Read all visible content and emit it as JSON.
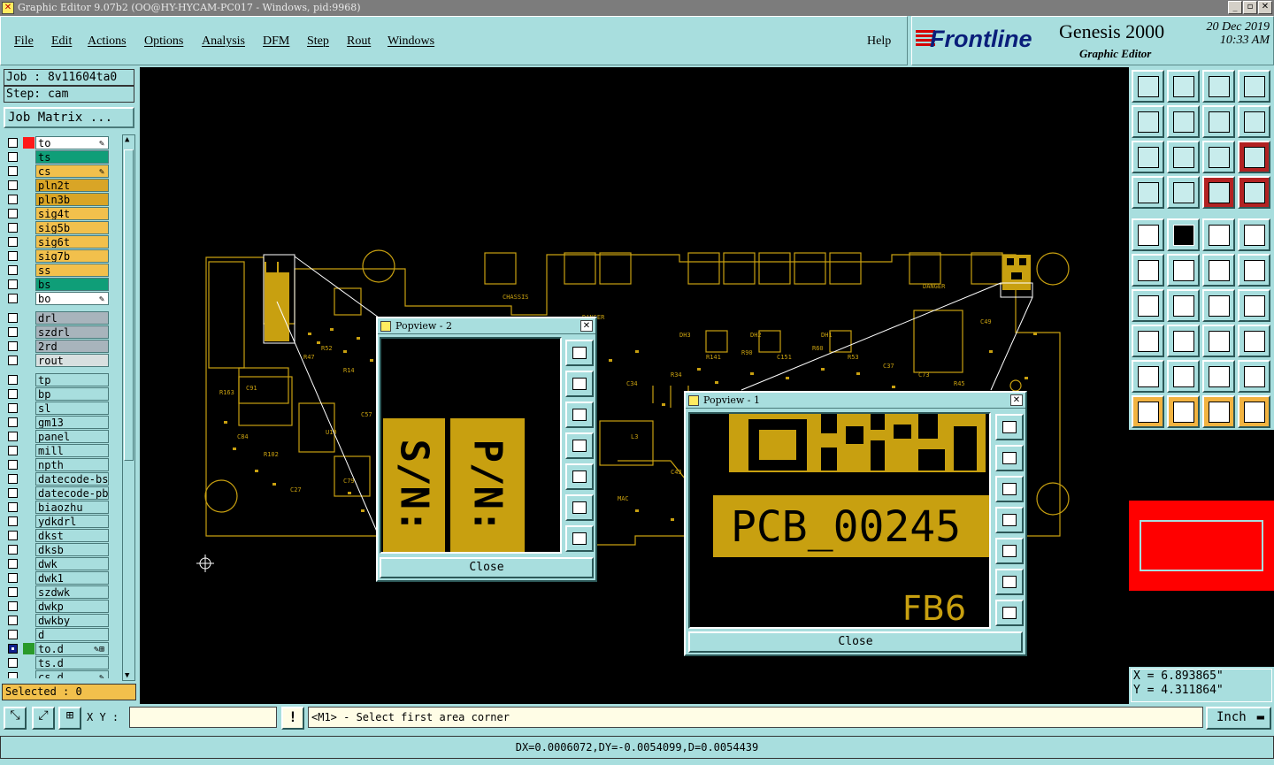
{
  "window": {
    "title": "Graphic Editor 9.07b2 (OO@HY-HYCAM-PC017 - Windows, pid:9968)"
  },
  "menu": [
    "File",
    "Edit",
    "Actions",
    "Options",
    "Analysis",
    "DFM",
    "Step",
    "Rout",
    "Windows"
  ],
  "help_label": "Help",
  "brand": {
    "logo": "Frontline",
    "product": "Genesis 2000",
    "subtitle": "Graphic Editor",
    "date": "20 Dec 2019",
    "time": "10:33 AM"
  },
  "job": {
    "job_label": "Job : 8v11604ta0",
    "step_label": "Step: cam",
    "matrix_button": "Job Matrix ..."
  },
  "layers": [
    {
      "name": "to",
      "color": "#ffffff",
      "swatch": "#ff1a1a",
      "mark": "✎",
      "checked": false
    },
    {
      "name": "ts",
      "color": "#0f9e78",
      "swatch": "",
      "mark": "",
      "checked": false
    },
    {
      "name": "cs",
      "color": "#f2c04c",
      "swatch": "",
      "mark": "✎",
      "checked": false
    },
    {
      "name": "pln2t",
      "color": "#d9a526",
      "swatch": "",
      "mark": "",
      "checked": false
    },
    {
      "name": "pln3b",
      "color": "#d9a526",
      "swatch": "",
      "mark": "",
      "checked": false
    },
    {
      "name": "sig4t",
      "color": "#f2c04c",
      "swatch": "",
      "mark": "",
      "checked": false
    },
    {
      "name": "sig5b",
      "color": "#f2c04c",
      "swatch": "",
      "mark": "",
      "checked": false
    },
    {
      "name": "sig6t",
      "color": "#f2c04c",
      "swatch": "",
      "mark": "",
      "checked": false
    },
    {
      "name": "sig7b",
      "color": "#f2c04c",
      "swatch": "",
      "mark": "",
      "checked": false
    },
    {
      "name": "ss",
      "color": "#f2c04c",
      "swatch": "",
      "mark": "",
      "checked": false
    },
    {
      "name": "bs",
      "color": "#0f9e78",
      "swatch": "",
      "mark": "",
      "checked": false
    },
    {
      "name": "bo",
      "color": "#ffffff",
      "swatch": "",
      "mark": "✎",
      "checked": false
    },
    {
      "gap": true
    },
    {
      "name": "drl",
      "color": "#a8b4bc",
      "swatch": "",
      "mark": "",
      "checked": false
    },
    {
      "name": "szdrl",
      "color": "#a8b4bc",
      "swatch": "",
      "mark": "",
      "checked": false
    },
    {
      "name": "2rd",
      "color": "#a8b4bc",
      "swatch": "",
      "mark": "",
      "checked": false
    },
    {
      "name": "rout",
      "color": "#d8e0e0",
      "swatch": "",
      "mark": "",
      "checked": false
    },
    {
      "gap": true
    },
    {
      "name": "tp",
      "color": "#a8dede",
      "swatch": "",
      "mark": "",
      "checked": false
    },
    {
      "name": "bp",
      "color": "#a8dede",
      "swatch": "",
      "mark": "",
      "checked": false
    },
    {
      "name": "sl",
      "color": "#a8dede",
      "swatch": "",
      "mark": "",
      "checked": false
    },
    {
      "name": "gm13",
      "color": "#a8dede",
      "swatch": "",
      "mark": "",
      "checked": false
    },
    {
      "name": "panel",
      "color": "#a8dede",
      "swatch": "",
      "mark": "",
      "checked": false
    },
    {
      "name": "mill",
      "color": "#a8dede",
      "swatch": "",
      "mark": "",
      "checked": false
    },
    {
      "name": "npth",
      "color": "#a8dede",
      "swatch": "",
      "mark": "",
      "checked": false
    },
    {
      "name": "datecode-bs",
      "color": "#a8dede",
      "swatch": "",
      "mark": "",
      "checked": false
    },
    {
      "name": "datecode-pbe",
      "color": "#a8dede",
      "swatch": "",
      "mark": "",
      "checked": false
    },
    {
      "name": "biaozhu",
      "color": "#a8dede",
      "swatch": "",
      "mark": "",
      "checked": false
    },
    {
      "name": "ydkdrl",
      "color": "#a8dede",
      "swatch": "",
      "mark": "",
      "checked": false
    },
    {
      "name": "dkst",
      "color": "#a8dede",
      "swatch": "",
      "mark": "",
      "checked": false
    },
    {
      "name": "dksb",
      "color": "#a8dede",
      "swatch": "",
      "mark": "",
      "checked": false
    },
    {
      "name": "dwk",
      "color": "#a8dede",
      "swatch": "",
      "mark": "",
      "checked": false
    },
    {
      "name": "dwk1",
      "color": "#a8dede",
      "swatch": "",
      "mark": "",
      "checked": false
    },
    {
      "name": "szdwk",
      "color": "#a8dede",
      "swatch": "",
      "mark": "",
      "checked": false
    },
    {
      "name": "dwkp",
      "color": "#a8dede",
      "swatch": "",
      "mark": "",
      "checked": false
    },
    {
      "name": "dwkby",
      "color": "#a8dede",
      "swatch": "",
      "mark": "",
      "checked": false
    },
    {
      "name": "d",
      "color": "#a8dede",
      "swatch": "",
      "mark": "",
      "checked": false
    },
    {
      "name": "to.d",
      "color": "#a8dede",
      "swatch": "#2a9a2a",
      "mark": "✎⊞",
      "checked": true
    },
    {
      "name": "ts.d",
      "color": "#a8dede",
      "swatch": "",
      "mark": "",
      "checked": false
    },
    {
      "name": "cs.d",
      "color": "#a8dede",
      "swatch": "",
      "mark": "✎",
      "checked": false
    }
  ],
  "selected_label": "Selected : 0",
  "popup2": {
    "title": "Popview - 2",
    "close": "Close",
    "text_left": "S/N:",
    "text_right": "P/N:"
  },
  "popup1": {
    "title": "Popview - 1",
    "close": "Close",
    "text_main": "PCB_00245",
    "text_small": "FB6"
  },
  "coords": {
    "x": "X = 6.893865\"",
    "y": "Y = 4.311864\""
  },
  "cmd": {
    "xy_label": "X Y :",
    "xy_value": "",
    "prompt": "<M1> - Select first area corner",
    "unit": "Inch"
  },
  "status": "DX=0.0006072,DY=-0.0054099,D=0.0054439",
  "colors": {
    "copper": "#c8a010",
    "canvas": "#000000",
    "panel": "#a8dede",
    "highlight": "#ff0000"
  }
}
